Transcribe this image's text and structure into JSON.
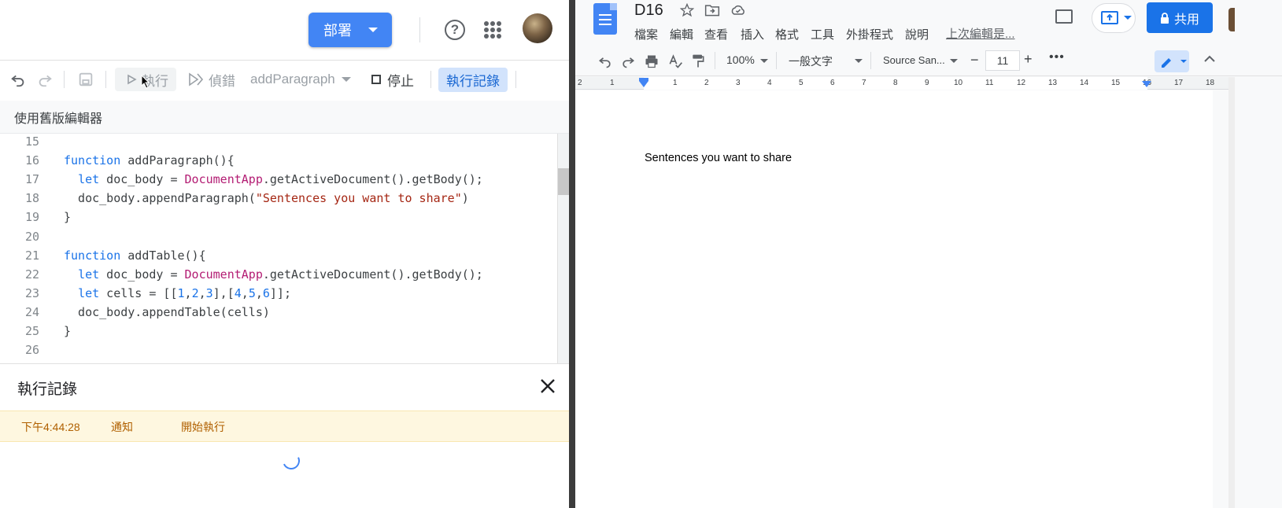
{
  "editor": {
    "deploy_label": "部署",
    "toolbar": {
      "run_label": "執行",
      "debug_label": "偵錯",
      "function_select": "addParagraph",
      "stop_label": "停止",
      "exec_log_label": "執行記錄"
    },
    "legacy_label": "使用舊版編輯器",
    "code_lines": [
      {
        "num": "15",
        "parts": []
      },
      {
        "num": "16",
        "parts": [
          {
            "t": "function",
            "c": "kw"
          },
          {
            "t": " addParagraph(){",
            "c": ""
          }
        ]
      },
      {
        "num": "17",
        "parts": [
          {
            "t": "  ",
            "c": ""
          },
          {
            "t": "let",
            "c": "kw"
          },
          {
            "t": " doc_body = ",
            "c": ""
          },
          {
            "t": "DocumentApp",
            "c": "cls"
          },
          {
            "t": ".getActiveDocument().getBody();",
            "c": ""
          }
        ]
      },
      {
        "num": "18",
        "parts": [
          {
            "t": "  doc_body.appendParagraph(",
            "c": ""
          },
          {
            "t": "\"Sentences you want to share\"",
            "c": "str"
          },
          {
            "t": ")",
            "c": ""
          }
        ]
      },
      {
        "num": "19",
        "parts": [
          {
            "t": "}",
            "c": ""
          }
        ]
      },
      {
        "num": "20",
        "parts": []
      },
      {
        "num": "21",
        "parts": [
          {
            "t": "function",
            "c": "kw"
          },
          {
            "t": " addTable(){",
            "c": ""
          }
        ]
      },
      {
        "num": "22",
        "parts": [
          {
            "t": "  ",
            "c": ""
          },
          {
            "t": "let",
            "c": "kw"
          },
          {
            "t": " doc_body = ",
            "c": ""
          },
          {
            "t": "DocumentApp",
            "c": "cls"
          },
          {
            "t": ".getActiveDocument().getBody();",
            "c": ""
          }
        ]
      },
      {
        "num": "23",
        "parts": [
          {
            "t": "  ",
            "c": ""
          },
          {
            "t": "let",
            "c": "kw"
          },
          {
            "t": " cells = [[",
            "c": ""
          },
          {
            "t": "1",
            "c": "num"
          },
          {
            "t": ",",
            "c": ""
          },
          {
            "t": "2",
            "c": "num"
          },
          {
            "t": ",",
            "c": ""
          },
          {
            "t": "3",
            "c": "num"
          },
          {
            "t": "],[",
            "c": ""
          },
          {
            "t": "4",
            "c": "num"
          },
          {
            "t": ",",
            "c": ""
          },
          {
            "t": "5",
            "c": "num"
          },
          {
            "t": ",",
            "c": ""
          },
          {
            "t": "6",
            "c": "num"
          },
          {
            "t": "]];",
            "c": ""
          }
        ]
      },
      {
        "num": "24",
        "parts": [
          {
            "t": "  doc_body.appendTable(cells)",
            "c": ""
          }
        ]
      },
      {
        "num": "25",
        "parts": [
          {
            "t": "}",
            "c": ""
          }
        ]
      },
      {
        "num": "26",
        "parts": []
      }
    ],
    "log": {
      "title": "執行記錄",
      "rows": [
        {
          "time": "下午4:44:28",
          "level": "通知",
          "message": "開始執行"
        }
      ]
    }
  },
  "docs": {
    "title": "D16",
    "menu": [
      "檔案",
      "編輯",
      "查看",
      "插入",
      "格式",
      "工具",
      "外掛程式",
      "說明"
    ],
    "last_edit": "上次編輯是...",
    "share_label": "共用",
    "toolbar": {
      "zoom": "100%",
      "style": "一般文字",
      "font": "Source San...",
      "font_size": "11"
    },
    "ruler_numbers": [
      "2",
      "1",
      "1",
      "2",
      "3",
      "4",
      "5",
      "6",
      "7",
      "8",
      "9",
      "10",
      "11",
      "12",
      "13",
      "14",
      "15",
      "16",
      "17",
      "18"
    ],
    "body_text": "Sentences you want to share"
  },
  "colors": {
    "accent": "#4285f4",
    "share": "#1a73e8",
    "log_highlight": "#fef7e0"
  }
}
